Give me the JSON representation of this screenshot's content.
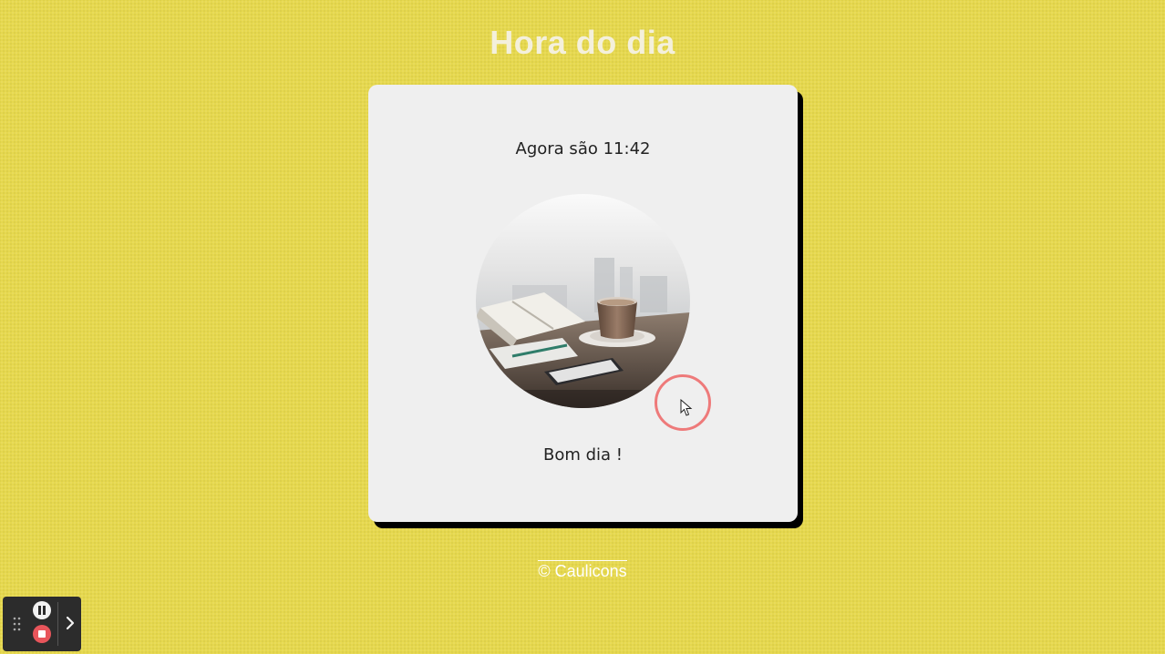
{
  "header": {
    "title": "Hora do dia"
  },
  "card": {
    "time_prefix": "Agora são",
    "time_value": "11:42",
    "greeting": "Bom dia !",
    "image": "morning-coffee-desk-photo"
  },
  "footer": {
    "credit": "© Caulicons"
  },
  "colors": {
    "background": "#e6d84e",
    "card": "#efefef",
    "card_shadow": "#000000",
    "title": "#f4f0dc",
    "click_indicator": "#ee7a7a",
    "recorder_bg": "#2c2c2c",
    "recorder_stop": "#e8555b"
  },
  "recorder": {
    "icons": [
      "drag-handle-icon",
      "pause-icon",
      "stop-icon",
      "chevron-right-icon"
    ]
  }
}
